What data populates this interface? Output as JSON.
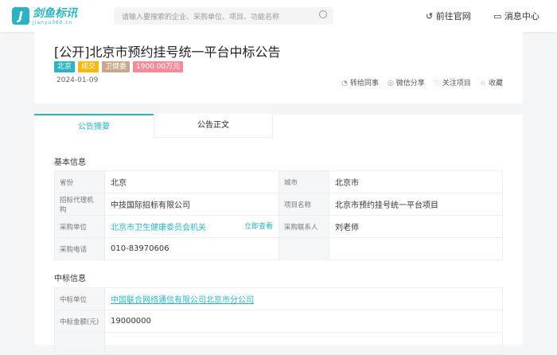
{
  "header": {
    "logo_mark": "J",
    "logo_text": "剑鱼标讯",
    "logo_sub": "jianyu360.cn",
    "search_placeholder": "请输入要搜索的企业、采购单位、项目、功能名称",
    "links": [
      {
        "icon": "return-icon",
        "label": "前往官网"
      },
      {
        "icon": "message-icon",
        "label": "消息中心"
      }
    ]
  },
  "notice": {
    "title": "[公开]北京市预约挂号统一平台中标公告",
    "tags": [
      {
        "label": "北京",
        "color": "#2bb3c4"
      },
      {
        "label": "成交",
        "color": "#fbb70a"
      },
      {
        "label": "卫健委",
        "color": "#c9a78a"
      },
      {
        "label": "1900.00万元",
        "color": "#f78a9a"
      }
    ],
    "date": "2024-01-09",
    "actions": [
      {
        "icon": "share-icon",
        "label": "转给同事"
      },
      {
        "icon": "wechat-icon",
        "label": "微信分享"
      },
      {
        "icon": "heart-icon",
        "label": "关注项目"
      },
      {
        "icon": "star-icon",
        "label": "收藏"
      }
    ]
  },
  "tabs": [
    "公告摘要",
    "公告正文"
  ],
  "basic": {
    "heading": "基本信息",
    "province_label": "省份",
    "province": "北京",
    "city_label": "城市",
    "city": "北京市",
    "agency_label": "招标代理机构",
    "agency": "中技国际招标有限公司",
    "project_label": "项目名称",
    "project": "北京市预约挂号统一平台项目",
    "buyer_label": "采购单位",
    "buyer": "北京市卫生健康委员会机关",
    "view_now": "立即查看",
    "contact_label": "采购联系人",
    "contact": "刘老师",
    "phone_label": "采购电话",
    "phone": "010-83970606"
  },
  "win": {
    "heading": "中标信息",
    "winner_label": "中标单位",
    "winner": "中国联合网络通信有限公司北京市分公司",
    "amount_label": "中标金额(元)",
    "amount": "19000000"
  }
}
